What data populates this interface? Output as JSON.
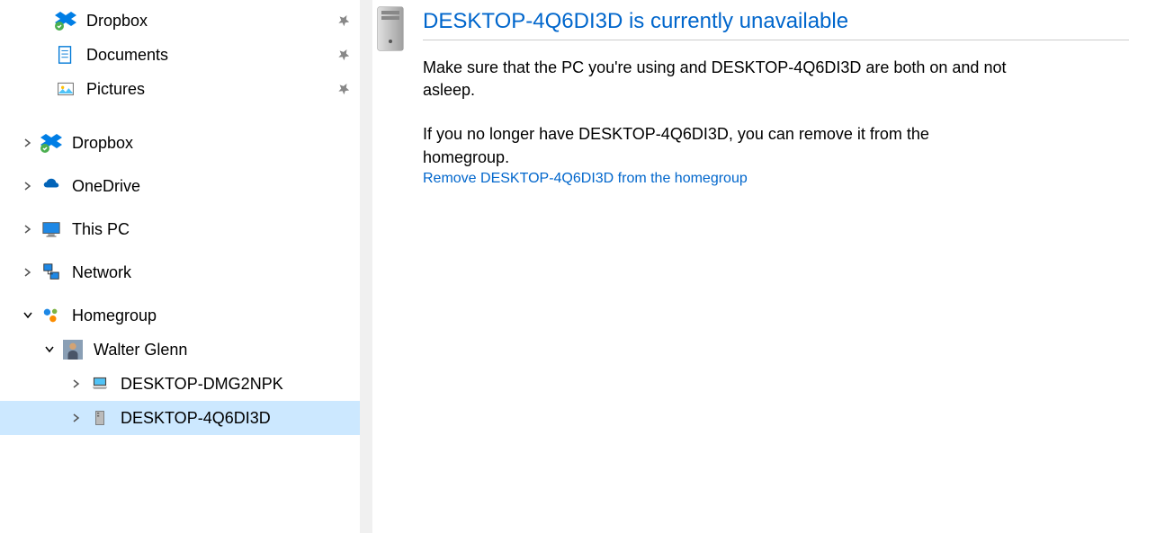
{
  "sidebar": {
    "quick": [
      {
        "label": "Dropbox",
        "icon": "dropbox-icon"
      },
      {
        "label": "Documents",
        "icon": "documents-icon"
      },
      {
        "label": "Pictures",
        "icon": "pictures-icon"
      }
    ],
    "roots": [
      {
        "label": "Dropbox",
        "icon": "dropbox-icon",
        "expanded": false
      },
      {
        "label": "OneDrive",
        "icon": "onedrive-icon",
        "expanded": false
      },
      {
        "label": "This PC",
        "icon": "thispc-icon",
        "expanded": false
      },
      {
        "label": "Network",
        "icon": "network-icon",
        "expanded": false
      }
    ],
    "homegroup": {
      "label": "Homegroup",
      "expanded": true,
      "user": {
        "label": "Walter Glenn",
        "expanded": true,
        "devices": [
          {
            "label": "DESKTOP-DMG2NPK",
            "icon": "laptop-icon",
            "selected": false
          },
          {
            "label": "DESKTOP-4Q6DI3D",
            "icon": "desktop-icon",
            "selected": true
          }
        ]
      }
    }
  },
  "content": {
    "title": "DESKTOP-4Q6DI3D is currently unavailable",
    "msg1": "Make sure that the PC you're using and DESKTOP-4Q6DI3D are both on and not asleep.",
    "msg2": "If you no longer have DESKTOP-4Q6DI3D, you can remove it from the homegroup.",
    "link": "Remove DESKTOP-4Q6DI3D from the homegroup"
  }
}
